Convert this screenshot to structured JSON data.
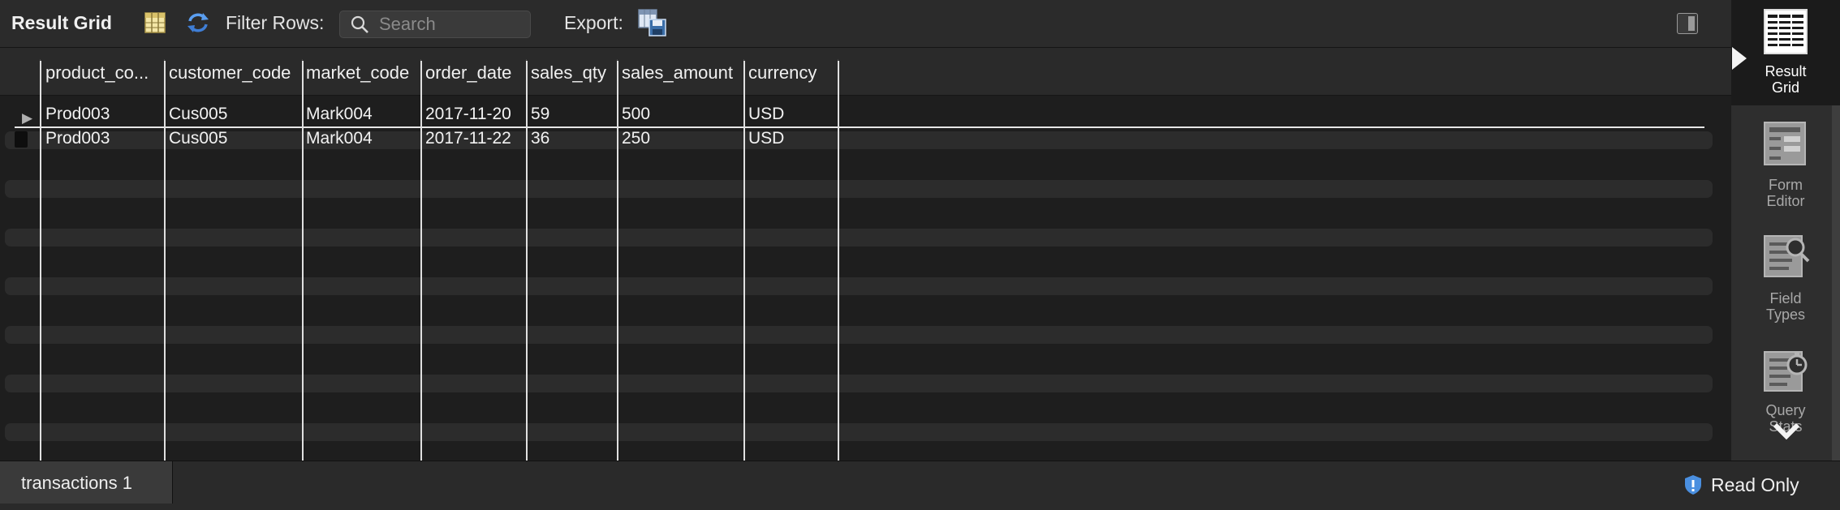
{
  "toolbar": {
    "title": "Result Grid",
    "filter_label": "Filter Rows:",
    "search_placeholder": "Search",
    "export_label": "Export:"
  },
  "grid": {
    "columns": [
      "product_co...",
      "customer_code",
      "market_code",
      "order_date",
      "sales_qty",
      "sales_amount",
      "currency"
    ],
    "rows": [
      [
        "Prod003",
        "Cus005",
        "Mark004",
        "2017-11-20",
        "59",
        "500",
        "USD"
      ],
      [
        "Prod003",
        "Cus005",
        "Mark004",
        "2017-11-22",
        "36",
        "250",
        "USD"
      ]
    ]
  },
  "side_panel": {
    "items": [
      {
        "line1": "Result",
        "line2": "Grid"
      },
      {
        "line1": "Form",
        "line2": "Editor"
      },
      {
        "line1": "Field",
        "line2": "Types"
      },
      {
        "line1": "Query",
        "line2": "Stats"
      }
    ]
  },
  "bottom": {
    "tab_label": "transactions 1",
    "status_label": "Read Only"
  },
  "colors": {
    "accent_blue": "#4a8fe0",
    "background": "#1e1e1e"
  }
}
